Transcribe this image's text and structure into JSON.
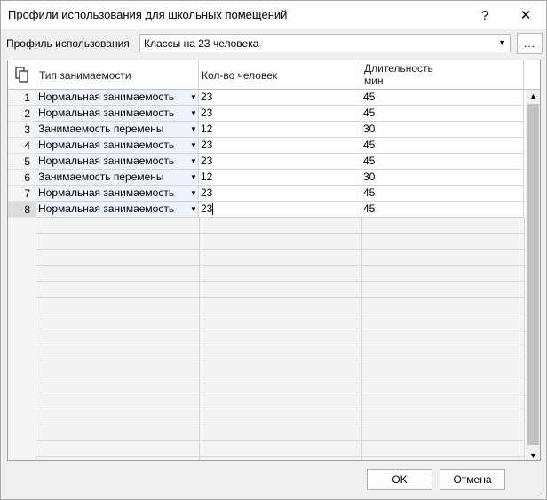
{
  "window": {
    "title": "Профили использования для школьных помещений",
    "help_label": "?",
    "close_label": "✕"
  },
  "profile": {
    "label": "Профиль использования",
    "value": "Классы на 23 человека",
    "browse_label": "..."
  },
  "grid": {
    "columns": {
      "type": "Тип занимаемости",
      "count": "Кол-во человек",
      "duration_line1": "Длительность",
      "duration_line2": "мин"
    },
    "rows": [
      {
        "num": "1",
        "type": "Нормальная занимаемость",
        "count": "23",
        "duration": "45"
      },
      {
        "num": "2",
        "type": "Нормальная занимаемость",
        "count": "23",
        "duration": "45"
      },
      {
        "num": "3",
        "type": "Занимаемость перемены",
        "count": "12",
        "duration": "30"
      },
      {
        "num": "4",
        "type": "Нормальная занимаемость",
        "count": "23",
        "duration": "45"
      },
      {
        "num": "5",
        "type": "Нормальная занимаемость",
        "count": "23",
        "duration": "45"
      },
      {
        "num": "6",
        "type": "Занимаемость перемены",
        "count": "12",
        "duration": "30"
      },
      {
        "num": "7",
        "type": "Нормальная занимаемость",
        "count": "23",
        "duration": "45"
      },
      {
        "num": "8",
        "type": "Нормальная занимаемость",
        "count": "23",
        "duration": "45"
      }
    ]
  },
  "buttons": {
    "ok": "OK",
    "cancel": "Отмена"
  },
  "colors": {
    "type_cell_bg": "#eef3fb",
    "active_row_num": "#dcdcdc"
  },
  "icons": {
    "copy": "copy-icon",
    "dropdown": "chevron-down-icon"
  }
}
